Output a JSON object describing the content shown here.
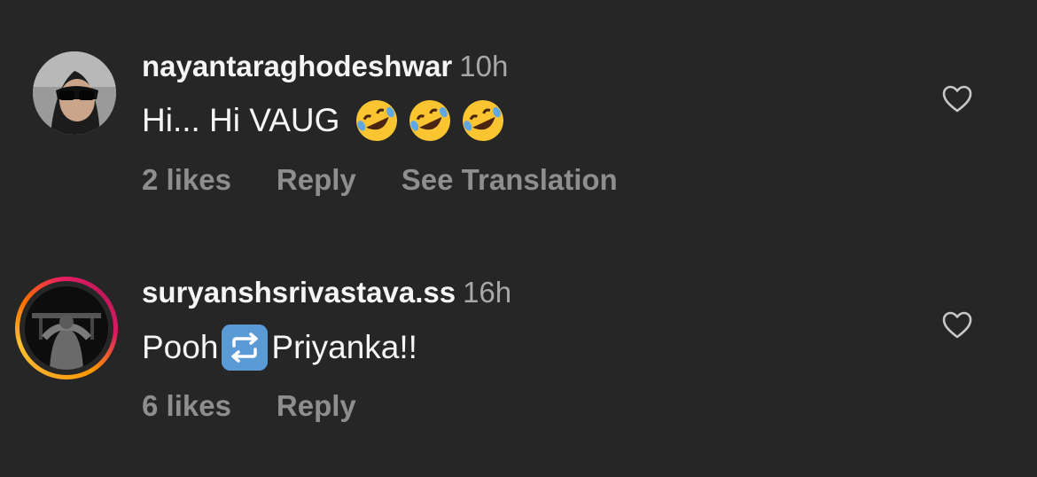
{
  "comments": [
    {
      "username": "nayantaraghodeshwar",
      "time": "10h",
      "text": "Hi... Hi VAUG",
      "emojis": [
        "rolling-on-floor-laughing",
        "rolling-on-floor-laughing",
        "rolling-on-floor-laughing"
      ],
      "actions": {
        "likes": "2 likes",
        "reply": "Reply",
        "translate": "See Translation"
      },
      "avatar_icon": "profile-photo",
      "has_story_ring": false
    },
    {
      "username": "suryanshsrivastava.ss",
      "time": "16h",
      "text_before": "Pooh",
      "text_after": "Priyanka!!",
      "inline_icon": "repeat-emoji",
      "actions": {
        "likes": "6 likes",
        "reply": "Reply"
      },
      "avatar_icon": "profile-photo",
      "has_story_ring": true
    }
  ],
  "colors": {
    "background": "#262626",
    "primary_text": "#f5f5f5",
    "secondary_text": "#8e8e8e",
    "time_text": "#a8a8a8"
  }
}
